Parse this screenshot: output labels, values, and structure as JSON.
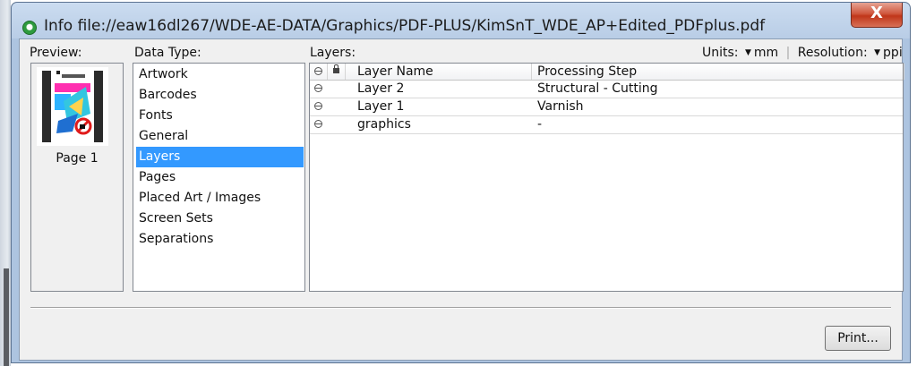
{
  "window": {
    "title": "Info file://eaw16dl267/WDE-AE-DATA/Graphics/PDF-PLUS/KimSnT_WDE_AP+Edited_PDFplus.pdf",
    "close_label": "X"
  },
  "preview": {
    "label": "Preview:",
    "caption": "Page 1"
  },
  "data_type": {
    "label": "Data Type:",
    "items": [
      {
        "label": "Artwork"
      },
      {
        "label": "Barcodes"
      },
      {
        "label": "Fonts"
      },
      {
        "label": "General"
      },
      {
        "label": "Layers",
        "selected": true
      },
      {
        "label": "Pages"
      },
      {
        "label": "Placed Art / Images"
      },
      {
        "label": "Screen Sets"
      },
      {
        "label": "Separations"
      }
    ]
  },
  "layers": {
    "label": "Layers:",
    "units_label": "Units:",
    "units_value": "mm",
    "resolution_label": "Resolution:",
    "resolution_value": "ppi",
    "columns": [
      "Layer Name",
      "Processing Step"
    ],
    "rows": [
      {
        "name": "Layer 2",
        "step": "Structural - Cutting"
      },
      {
        "name": "Layer 1",
        "step": "Varnish"
      },
      {
        "name": "graphics",
        "step": "-"
      }
    ]
  },
  "footer": {
    "print_label": "Print..."
  },
  "colors": {
    "selection": "#3399ff",
    "close_button": "#c0361a"
  },
  "icons": [
    "app-icon",
    "close-icon",
    "visibility-icon",
    "lock-icon",
    "dropdown-caret-icon"
  ]
}
